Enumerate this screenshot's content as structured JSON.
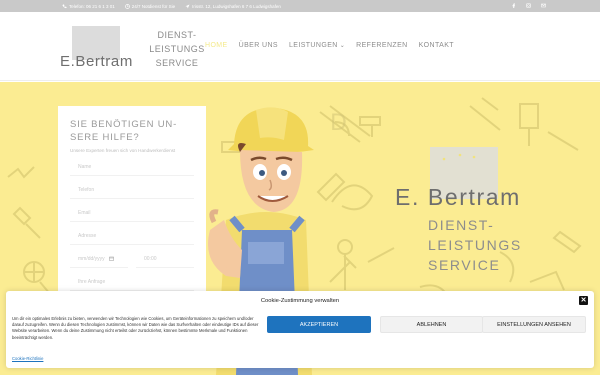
{
  "topbar": {
    "phone": "Telefon: 06 21 6 1 3 01",
    "hours": "24/7 Notdienst für Sie",
    "address": "Irisstr. 12, Ludwigshafen 6 7 6 Ludwigshafen"
  },
  "header": {
    "logo_name": "E.Bertram",
    "logo_tagline": "DIENST-\nLEISTUNGS\nSERVICE",
    "nav": [
      {
        "label": "HOME",
        "active": true
      },
      {
        "label": "ÜBER UNS",
        "active": false
      },
      {
        "label": "LEISTUNGEN",
        "active": false,
        "dropdown": true
      },
      {
        "label": "REFERENZEN",
        "active": false
      },
      {
        "label": "KONTAKT",
        "active": false
      }
    ]
  },
  "form": {
    "heading": "SIE BENÖTIGEN UN-\nSERE HILFE?",
    "subheading": "Unsere Experten freuen sich von Handwerkerdienst",
    "fields": {
      "name": "Name",
      "phone": "Telefon",
      "email": "Email",
      "address": "Adresse",
      "date": "mm/dd/yyyy",
      "time": "00:00",
      "message": "Ihre Anfrage"
    }
  },
  "hero": {
    "name": "E. Bertram",
    "tagline": "DIENST-\nLEISTUNGS\nSERVICE"
  },
  "cookie": {
    "title": "Cookie-Zustimmung verwalten",
    "text": "Um dir ein optimales Erlebnis zu bieten, verwenden wir Technologien wie Cookies, um Geräteinformationen zu speichern und/oder darauf zuzugreifen. Wenn du diesen Technologien zustimmst, können wir Daten wie das Surfverhalten oder eindeutige IDs auf dieser Website verarbeiten. Wenn du deine Zustimmung nicht erteilst oder zurückziehst, können bestimmte Merkmale und Funktionen beeinträchtigt werden.",
    "accept": "AKZEPTIEREN",
    "deny": "ABLEHNEN",
    "prefs": "EINSTELLUNGEN ANSEHEN",
    "policy": "Cookie-Richtlinie",
    "close": "✕"
  },
  "colors": {
    "hero_bg": "#fbec92",
    "accent_blue": "#1e73be",
    "nav_active": "#f4ea8c"
  }
}
